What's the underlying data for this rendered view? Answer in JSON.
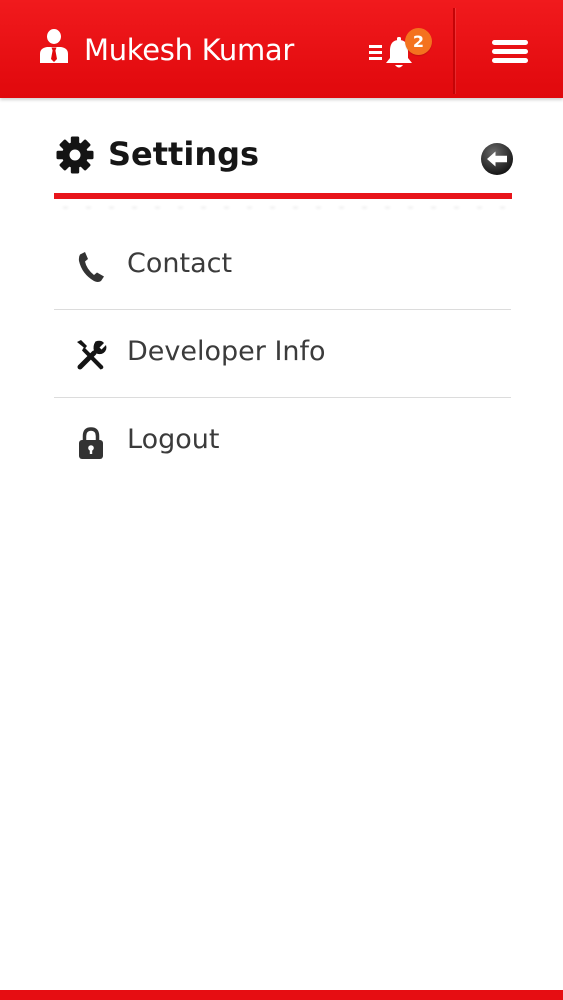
{
  "header": {
    "user_icon": "user-icon",
    "user_name": "Mukesh Kumar",
    "notification_icon": "bell-icon",
    "notification_count": "2",
    "menu_icon": "hamburger-menu-icon",
    "background_color": "#e50b0f"
  },
  "settings": {
    "icon": "gear-icon",
    "title": "Settings",
    "back_icon": "back-arrow-icon",
    "accent_color": "#e8151b"
  },
  "menu_items": [
    {
      "label": "Contact",
      "icon": "phone-icon"
    },
    {
      "label": "Developer Info",
      "icon": "tools-icon"
    },
    {
      "label": "Logout",
      "icon": "lock-icon"
    }
  ]
}
